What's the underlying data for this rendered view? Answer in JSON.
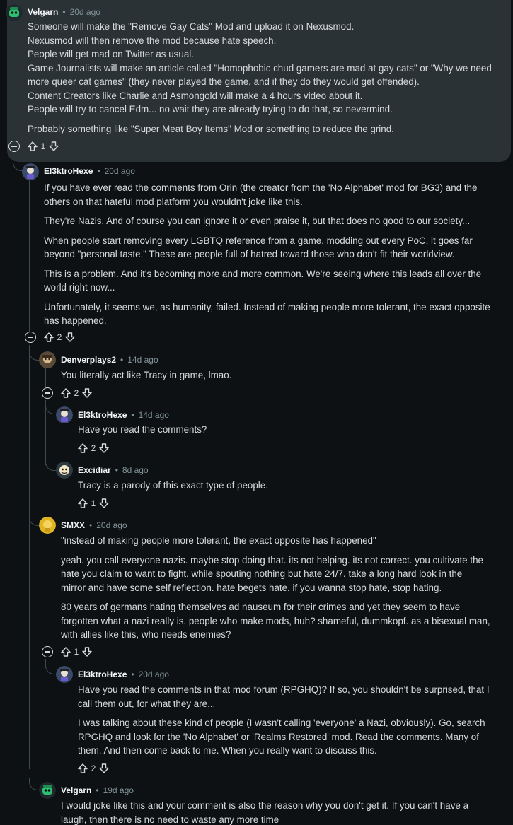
{
  "comments": [
    {
      "author": "Velgarn",
      "age": "20d ago",
      "votes": "1",
      "lines": [
        "Someone will make the \"Remove Gay Cats\" Mod and upload it on Nexusmod.",
        "Nexusmod will then remove the mod because hate speech.",
        "People will get mad on Twitter as usual.",
        "Game Journalists will make an article called \"Homophobic chud gamers are mad at gay cats\" or \"Why we need",
        "more queer cat games\" (they never played the game, and if they do they would get offended).",
        "Content Creators like Charlie and Asmongold will make a 4 hours video about it.",
        "People will try to cancel Edm... no wait they are already trying to do that, so nevermind.",
        "Probably something like \"Super Meat Boy Items\" Mod or something to reduce the grind."
      ]
    },
    {
      "author": "El3ktroHexe",
      "age": "20d ago",
      "votes": "2",
      "lines": [
        "If you have ever read the comments from Orin (the creator from the 'No Alphabet' mod for BG3) and the",
        "others on that hateful mod platform you wouldn't joke like this.",
        "They're Nazis. And of course you can ignore it or even praise it, but that does no good to our society...",
        "When people start removing every LGBTQ reference from a game, modding out every PoC, it goes far",
        "beyond \"personal taste.\" These are people full of hatred toward those who don't fit their worldview.",
        "This is a problem. And it's becoming more and more common. We're seeing where this leads all over the",
        "world right now...",
        "Unfortunately, it seems we, as humanity, failed. Instead of making people more tolerant, the exact opposite",
        "has happened."
      ]
    },
    {
      "author": "Denverplays2",
      "age": "14d ago",
      "votes": "2",
      "lines": [
        "You literally act like Tracy in game, lmao."
      ]
    },
    {
      "author": "El3ktroHexe",
      "age": "14d ago",
      "votes": "2",
      "lines": [
        "Have you read the comments?"
      ]
    },
    {
      "author": "Excidiar",
      "age": "8d ago",
      "votes": "1",
      "lines": [
        "Tracy is a parody of this exact type of people."
      ]
    },
    {
      "author": "SMXX",
      "age": "20d ago",
      "votes": "1",
      "lines": [
        "\"instead of making people more tolerant, the exact opposite has happened\"",
        "yeah. you call everyone nazis. maybe stop doing that. its not helping. its not correct. you cultivate the",
        "hate you claim to want to fight, while spouting nothing but hate 24/7. take a long hard look in the",
        "mirror and have some self reflection. hate begets hate. if you wanna stop hate, stop hating.",
        "80 years of germans hating themselves ad nauseum for their crimes and yet they seem to have",
        "forgotten what a nazi really is. people who make mods, huh? shameful, dummkopf. as a bisexual man,",
        "with allies like this, who needs enemies?"
      ]
    },
    {
      "author": "El3ktroHexe",
      "age": "20d ago",
      "votes": "2",
      "lines": [
        "Have you read the comments in that mod forum (RPGHQ)? If so, you shouldn't be surprised, that I",
        "call them out, for what they are...",
        "I was talking about these kind of people (I wasn't calling 'everyone' a Nazi, obviously). Go, search",
        "RPGHQ and look for the 'No Alphabet' or 'Realms Restored' mod. Read the comments. Many of",
        "them. And then come back to me. When you really want to discuss this."
      ]
    },
    {
      "author": "Velgarn",
      "age": "19d ago",
      "votes": "",
      "lines": [
        "I would joke like this and your comment is also the reason why you don't get it. If you can't have a",
        "laugh, then there is no need to waste any more time"
      ]
    }
  ],
  "separator": "•",
  "colors": {
    "bg": "#0e1113",
    "highlight": "#2a3236",
    "muted": "#82959b",
    "line": "#3e4a50"
  }
}
